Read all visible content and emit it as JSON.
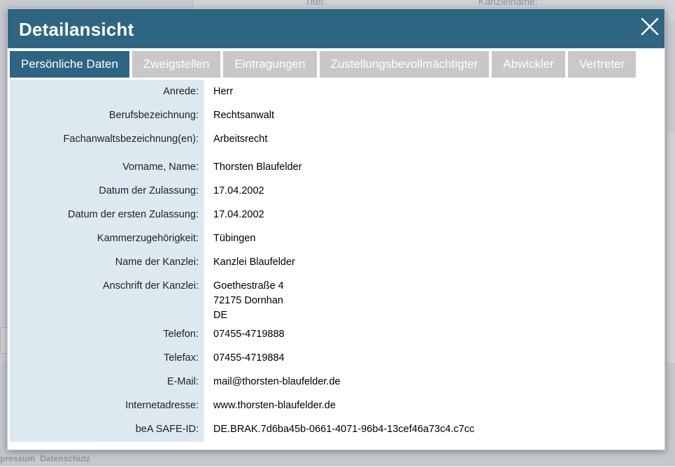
{
  "background": {
    "field_label_1": "Titel:",
    "field_label_2": "Kanzleiname:",
    "footer_links": [
      "pressum",
      "Datenschutz"
    ]
  },
  "modal": {
    "title": "Detailansicht",
    "close_label": "×"
  },
  "tabs": [
    {
      "label": "Persönliche Daten",
      "active": true
    },
    {
      "label": "Zweigstellen",
      "active": false
    },
    {
      "label": "Eintragungen",
      "active": false
    },
    {
      "label": "Zustellungsbevollmächtigter",
      "active": false
    },
    {
      "label": "Abwickler",
      "active": false
    },
    {
      "label": "Vertreter",
      "active": false
    }
  ],
  "details": {
    "anrede": {
      "label": "Anrede:",
      "value": "Herr"
    },
    "beruf": {
      "label": "Berufsbezeichnung:",
      "value": "Rechtsanwalt"
    },
    "fachanwalt": {
      "label": "Fachanwaltsbezeichnung(en):",
      "value": "Arbeitsrecht"
    },
    "name": {
      "label": "Vorname, Name:",
      "value": "Thorsten Blaufelder"
    },
    "zulassung": {
      "label": "Datum der Zulassung:",
      "value": "17.04.2002"
    },
    "erste_zulassung": {
      "label": "Datum der ersten Zulassung:",
      "value": "17.04.2002"
    },
    "kammer": {
      "label": "Kammerzugehörigkeit:",
      "value": "Tübingen"
    },
    "kanzlei_name": {
      "label": "Name der Kanzlei:",
      "value": "Kanzlei Blaufelder"
    },
    "anschrift": {
      "label": "Anschrift der Kanzlei:",
      "line1": "Goethestraße 4",
      "line2": "72175 Dornhan",
      "line3": "DE"
    },
    "telefon": {
      "label": "Telefon:",
      "value": "07455-4719888"
    },
    "telefax": {
      "label": "Telefax:",
      "value": "07455-4719884"
    },
    "email": {
      "label": "E-Mail:",
      "value": "mail@thorsten-blaufelder.de"
    },
    "internet": {
      "label": "Internetadresse:",
      "value": "www.thorsten-blaufelder.de"
    },
    "safe_id": {
      "label": "beA SAFE-ID:",
      "value": "DE.BRAK.7d6ba45b-0661-4071-96b4-13cef46a73c4.c7cc"
    }
  },
  "colors": {
    "header": "#2e6582",
    "tab_inactive": "#c8c8c8",
    "label_column": "#dde9f0"
  }
}
